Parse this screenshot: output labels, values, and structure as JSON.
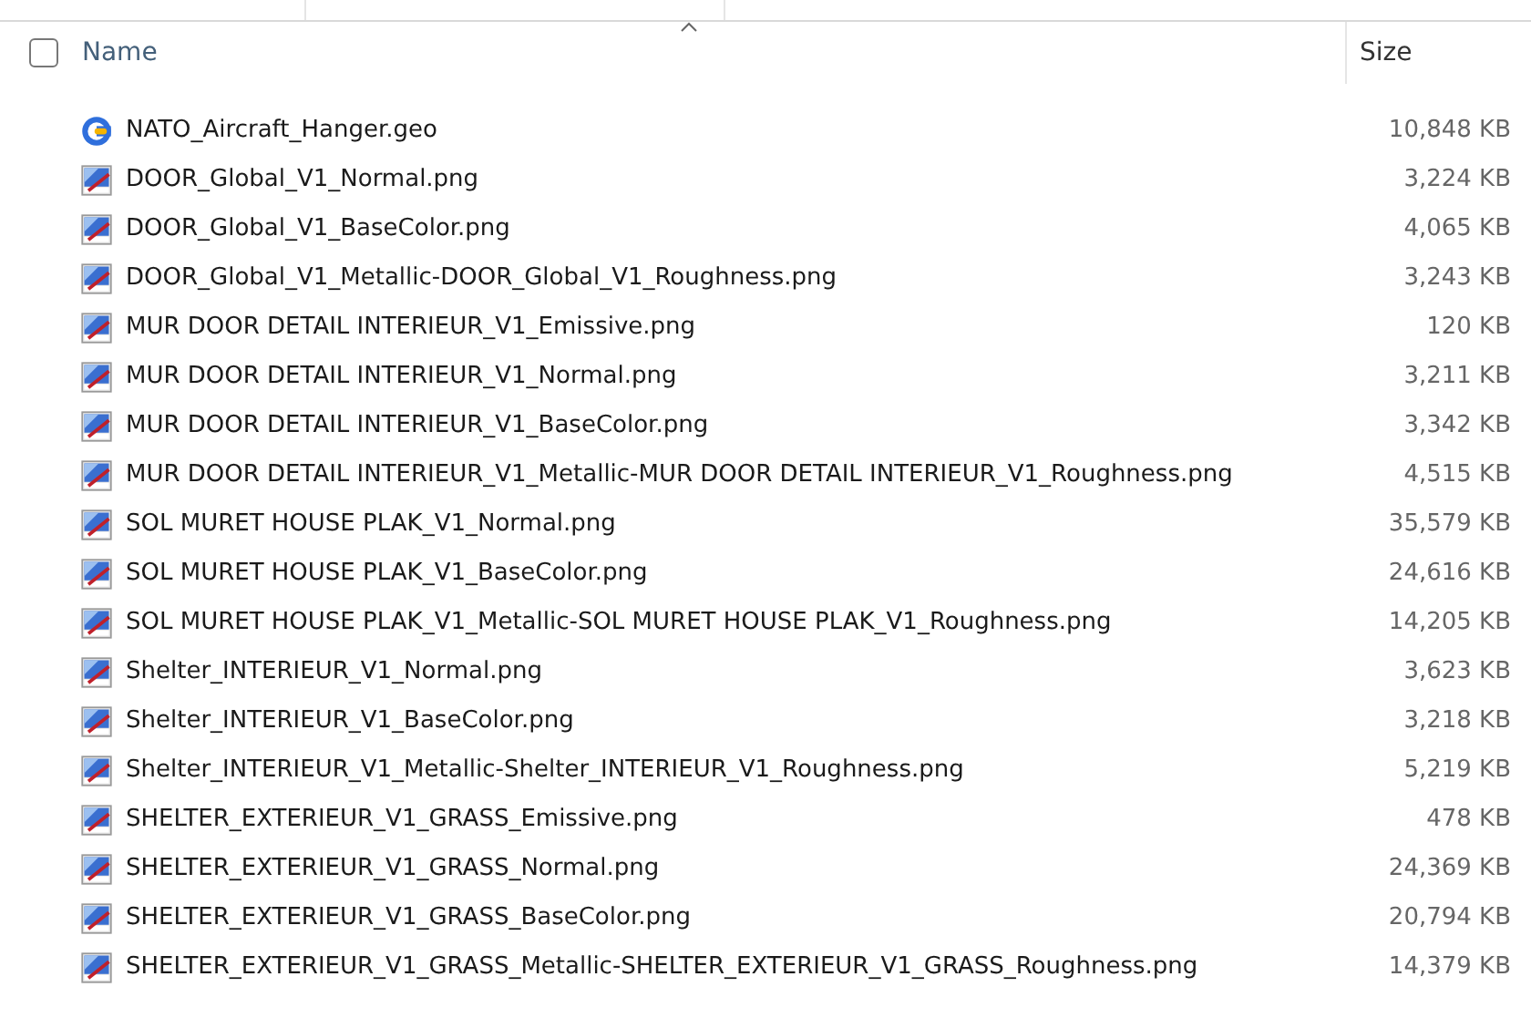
{
  "header": {
    "select_all": {
      "checked": false
    },
    "columns": [
      {
        "label": "Name",
        "sorted": true
      },
      {
        "label": "Size",
        "sorted": false
      }
    ]
  },
  "rows": [
    {
      "kind": "geo",
      "name": "NATO_Aircraft_Hanger.geo",
      "size": "10,848 KB"
    },
    {
      "kind": "image",
      "name": "DOOR_Global_V1_Normal.png",
      "size": "3,224 KB"
    },
    {
      "kind": "image",
      "name": "DOOR_Global_V1_BaseColor.png",
      "size": "4,065 KB"
    },
    {
      "kind": "image",
      "name": "DOOR_Global_V1_Metallic-DOOR_Global_V1_Roughness.png",
      "size": "3,243 KB"
    },
    {
      "kind": "image",
      "name": "MUR DOOR DETAIL INTERIEUR_V1_Emissive.png",
      "size": "120 KB"
    },
    {
      "kind": "image",
      "name": "MUR DOOR DETAIL INTERIEUR_V1_Normal.png",
      "size": "3,211 KB"
    },
    {
      "kind": "image",
      "name": "MUR DOOR DETAIL INTERIEUR_V1_BaseColor.png",
      "size": "3,342 KB"
    },
    {
      "kind": "image",
      "name": "MUR DOOR DETAIL INTERIEUR_V1_Metallic-MUR DOOR DETAIL INTERIEUR_V1_Roughness.png",
      "size": "4,515 KB"
    },
    {
      "kind": "image",
      "name": "SOL MURET HOUSE PLAK_V1_Normal.png",
      "size": "35,579 KB"
    },
    {
      "kind": "image",
      "name": "SOL MURET HOUSE PLAK_V1_BaseColor.png",
      "size": "24,616 KB"
    },
    {
      "kind": "image",
      "name": "SOL MURET HOUSE PLAK_V1_Metallic-SOL MURET HOUSE PLAK_V1_Roughness.png",
      "size": "14,205 KB"
    },
    {
      "kind": "image",
      "name": "Shelter_INTERIEUR_V1_Normal.png",
      "size": "3,623 KB"
    },
    {
      "kind": "image",
      "name": "Shelter_INTERIEUR_V1_BaseColor.png",
      "size": "3,218 KB"
    },
    {
      "kind": "image",
      "name": "Shelter_INTERIEUR_V1_Metallic-Shelter_INTERIEUR_V1_Roughness.png",
      "size": "5,219 KB"
    },
    {
      "kind": "image",
      "name": "SHELTER_EXTERIEUR_V1_GRASS_Emissive.png",
      "size": "478 KB"
    },
    {
      "kind": "image",
      "name": "SHELTER_EXTERIEUR_V1_GRASS_Normal.png",
      "size": "24,369 KB"
    },
    {
      "kind": "image",
      "name": "SHELTER_EXTERIEUR_V1_GRASS_BaseColor.png",
      "size": "20,794 KB"
    },
    {
      "kind": "image",
      "name": "SHELTER_EXTERIEUR_V1_GRASS_Metallic-SHELTER_EXTERIEUR_V1_GRASS_Roughness.png",
      "size": "14,379 KB"
    }
  ]
}
